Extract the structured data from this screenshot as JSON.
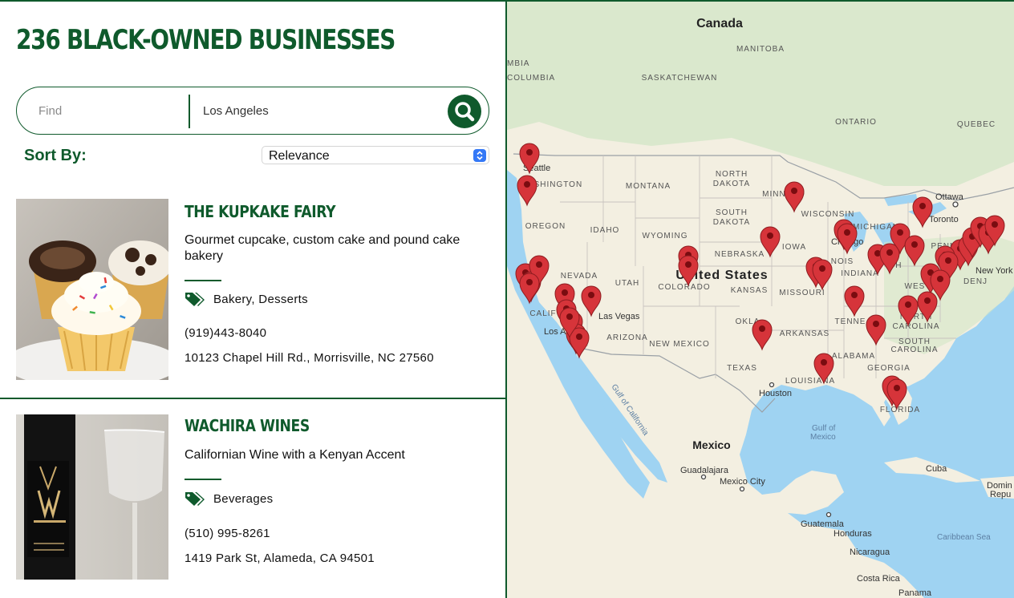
{
  "header": {
    "title": "236 BLACK-OWNED BUSINESSES"
  },
  "search": {
    "find_placeholder": "Find",
    "location_value": "Los Angeles"
  },
  "sort": {
    "label": "Sort By:",
    "selected": "Relevance"
  },
  "listings": [
    {
      "name": "THE KUPKAKE FAIRY",
      "description": "Gourmet cupcake, custom cake and pound cake bakery",
      "categories": "Bakery, Desserts",
      "phone": "(919)443-8040",
      "address": "10123 Chapel Hill Rd., Morrisville, NC 27560"
    },
    {
      "name": "WACHIRA WINES",
      "description": "Californian Wine with a Kenyan Accent",
      "categories": "Beverages",
      "phone": "(510) 995-8261",
      "address": "1419 Park St, Alameda, CA 94501"
    }
  ],
  "map": {
    "countries": {
      "canada": "Canada",
      "united_states": "United States",
      "mexico": "Mexico"
    },
    "provinces": {
      "columbia": "COLUMBIA",
      "manitoba": "MANITOBA",
      "saskatchewan": "SASKATCHEWAN",
      "ontario": "ONTARIO",
      "quebec": "QUEBEC"
    },
    "states": {
      "washington": "WASHINGTON",
      "oregon": "OREGON",
      "idaho": "IDAHO",
      "montana": "MONTANA",
      "wyoming": "WYOMING",
      "nevada": "NEVADA",
      "utah": "UTAH",
      "colorado": "COLORADO",
      "california": "CALIF",
      "arizona": "ARIZONA",
      "new_mexico": "NEW MEXICO",
      "north_dakota_1": "NORTH",
      "north_dakota_2": "DAKOTA",
      "south_dakota_1": "SOUTH",
      "south_dakota_2": "DAKOTA",
      "nebraska": "NEBRASKA",
      "kansas": "KANSAS",
      "oklahoma": "OKLA",
      "texas": "TEXAS",
      "minnesota": "MINNESO",
      "iowa": "IOWA",
      "missouri": "MISSOURI",
      "arkansas": "ARKANSAS",
      "louisiana": "LOUISIANA",
      "wisconsin": "WISCONSIN",
      "michigan": "MICHIGAN",
      "illinois": "NOIS",
      "indiana": "INDIANA",
      "ohio": "OH",
      "tennessee": "TENNE",
      "alabama": "ALABAMA",
      "georgia": "GEORGIA",
      "north_carolina_1": "NORTH",
      "north_carolina_2": "CAROLINA",
      "south_carolina_1": "SOUTH",
      "south_carolina_2": "CAROLINA",
      "west_virginia": "WEST",
      "pennsylvania": "PENNSY",
      "florida": "FLORIDA",
      "maryland": "DENJ",
      "mbia": "MBIA"
    },
    "cities": {
      "seattle": "Seattle",
      "las_vegas": "Las Vegas",
      "los_angeles": "Los A",
      "chicago": "Chicago",
      "toronto": "Toronto",
      "ottawa": "Ottawa",
      "new_york": "New York",
      "houston": "Houston",
      "guadalajara": "Guadalajara",
      "mexico_city": "Mexico City",
      "guatemala": "Guatemala",
      "honduras": "Honduras",
      "nicaragua": "Nicaragua",
      "costa_rica": "Costa Rica",
      "panama": "Panama",
      "cuba": "Cuba",
      "dominican_1": "Domin",
      "dominican_2": "Repu"
    },
    "water": {
      "gulf_mexico_1": "Gulf of",
      "gulf_mexico_2": "Mexico",
      "gulf_california": "Gulf of California",
      "caribbean": "Caribbean Sea"
    },
    "land_color": "#f3efe1",
    "water_color": "#9fd3f2",
    "marker_color": "#d6343a"
  }
}
